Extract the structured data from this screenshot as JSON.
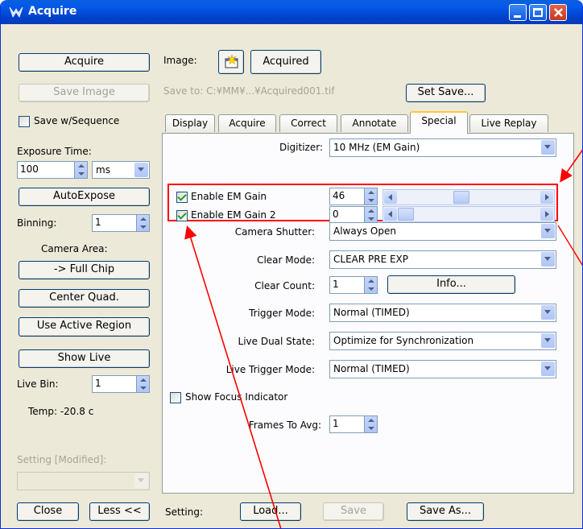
{
  "window": {
    "title": "Acquire"
  },
  "left": {
    "acquire": "Acquire",
    "save_image": "Save Image",
    "save_sequence": "Save w/Sequence",
    "exposure_label": "Exposure Time:",
    "exposure_value": "100",
    "exposure_unit": "ms",
    "autoexpose": "AutoExpose",
    "binning_label": "Binning:",
    "binning_value": "1",
    "camera_area": "Camera Area:",
    "full_chip": "-> Full Chip",
    "center_quad": "Center Quad.",
    "active_region": "Use Active Region",
    "show_live": "Show Live",
    "live_bin_label": "Live Bin:",
    "live_bin_value": "1",
    "temp": "Temp: -20.8 c",
    "setting_modified": "Setting [Modified]:",
    "close": "Close",
    "less": "Less <<"
  },
  "top": {
    "image_label": "Image:",
    "acquired": "Acquired",
    "save_to": "Save to: C:¥MM¥...¥Acquired001.tif",
    "set_save": "Set Save..."
  },
  "tabs": [
    "Display",
    "Acquire",
    "Correct",
    "Annotate",
    "Special",
    "Live Replay"
  ],
  "active_tab": "Special",
  "special": {
    "digitizer_label": "Digitizer:",
    "digitizer_value": "10 MHz (EM Gain)",
    "em_gain_label": "Enable EM Gain",
    "em_gain_value": "46",
    "em_gain_level": 0.45,
    "em_gain2_label": "Enable EM Gain 2",
    "em_gain2_value": "0",
    "em_gain2_level": 0.0,
    "shutter_label": "Camera Shutter:",
    "shutter_value": "Always Open",
    "clear_mode_label": "Clear Mode:",
    "clear_mode_value": "CLEAR PRE EXP",
    "clear_count_label": "Clear Count:",
    "clear_count_value": "1",
    "info": "Info...",
    "trigger_label": "Trigger Mode:",
    "trigger_value": "Normal (TIMED)",
    "live_dual_label": "Live Dual State:",
    "live_dual_value": "Optimize for Synchronization",
    "live_trigger_label": "Live Trigger Mode:",
    "live_trigger_value": "Normal (TIMED)",
    "focus_label": "Show Focus Indicator",
    "frames_label": "Frames To Avg:",
    "frames_value": "1"
  },
  "bottom": {
    "setting_label": "Setting:",
    "load": "Load...",
    "save": "Save",
    "save_as": "Save As..."
  },
  "colors": {
    "highlight": "#ff0000",
    "titlebar": "#0458e8"
  }
}
